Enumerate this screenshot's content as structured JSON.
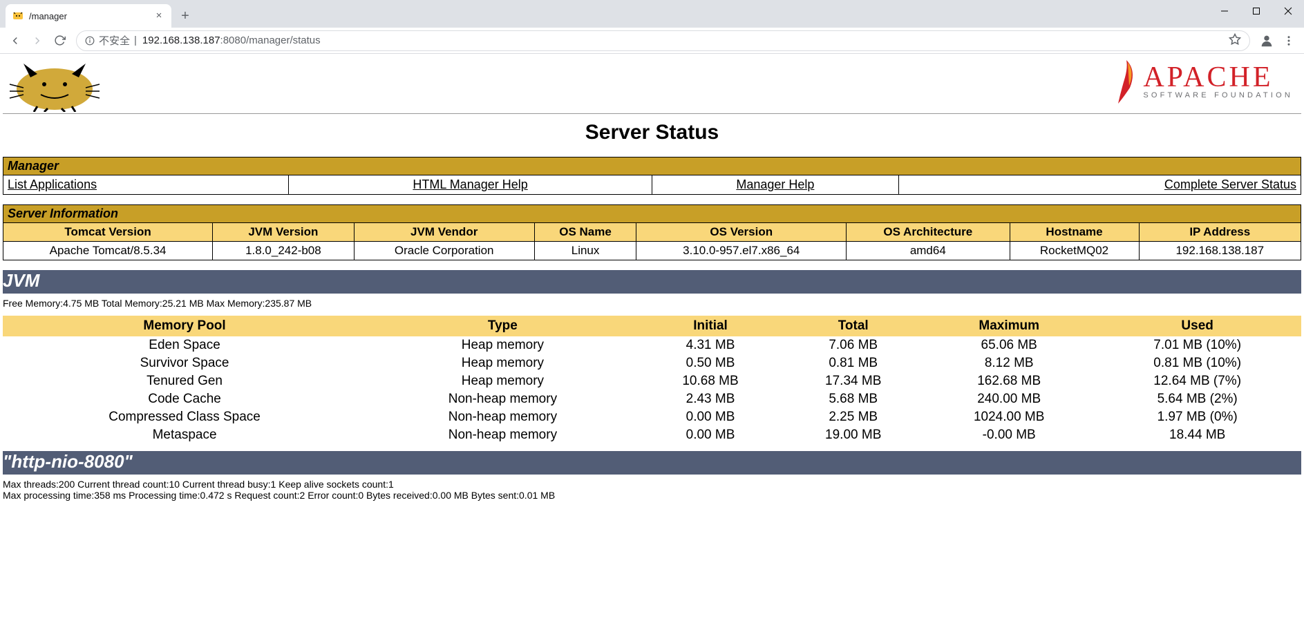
{
  "browser": {
    "tab_title": "/manager",
    "insecure_label": "不安全",
    "url_host": "192.168.138.187",
    "url_port": ":8080",
    "url_path": "/manager/status"
  },
  "header": {
    "page_title": "Server Status",
    "apache_title": "APACHE",
    "apache_sub": "SOFTWARE FOUNDATION"
  },
  "manager": {
    "section": "Manager",
    "links": {
      "list_apps": "List Applications",
      "html_help": "HTML Manager Help",
      "manager_help": "Manager Help",
      "complete_status": "Complete Server Status"
    }
  },
  "server_info": {
    "section": "Server Information",
    "headers": {
      "tomcat_version": "Tomcat Version",
      "jvm_version": "JVM Version",
      "jvm_vendor": "JVM Vendor",
      "os_name": "OS Name",
      "os_version": "OS Version",
      "os_arch": "OS Architecture",
      "hostname": "Hostname",
      "ip": "IP Address"
    },
    "row": {
      "tomcat_version": "Apache Tomcat/8.5.34",
      "jvm_version": "1.8.0_242-b08",
      "jvm_vendor": "Oracle Corporation",
      "os_name": "Linux",
      "os_version": "3.10.0-957.el7.x86_64",
      "os_arch": "amd64",
      "hostname": "RocketMQ02",
      "ip": "192.168.138.187"
    }
  },
  "jvm": {
    "title": "JVM",
    "summary": "Free Memory:4.75 MB Total Memory:25.21 MB Max Memory:235.87 MB",
    "headers": {
      "pool": "Memory Pool",
      "type": "Type",
      "initial": "Initial",
      "total": "Total",
      "max": "Maximum",
      "used": "Used"
    },
    "rows": [
      {
        "pool": "Eden Space",
        "type": "Heap memory",
        "initial": "4.31 MB",
        "total": "7.06 MB",
        "max": "65.06 MB",
        "used": "7.01 MB (10%)"
      },
      {
        "pool": "Survivor Space",
        "type": "Heap memory",
        "initial": "0.50 MB",
        "total": "0.81 MB",
        "max": "8.12 MB",
        "used": "0.81 MB (10%)"
      },
      {
        "pool": "Tenured Gen",
        "type": "Heap memory",
        "initial": "10.68 MB",
        "total": "17.34 MB",
        "max": "162.68 MB",
        "used": "12.64 MB (7%)"
      },
      {
        "pool": "Code Cache",
        "type": "Non-heap memory",
        "initial": "2.43 MB",
        "total": "5.68 MB",
        "max": "240.00 MB",
        "used": "5.64 MB (2%)"
      },
      {
        "pool": "Compressed Class Space",
        "type": "Non-heap memory",
        "initial": "0.00 MB",
        "total": "2.25 MB",
        "max": "1024.00 MB",
        "used": "1.97 MB (0%)"
      },
      {
        "pool": "Metaspace",
        "type": "Non-heap memory",
        "initial": "0.00 MB",
        "total": "19.00 MB",
        "max": "-0.00 MB",
        "used": "18.44 MB"
      }
    ]
  },
  "connector": {
    "title": "\"http-nio-8080\"",
    "line1": "Max threads:200 Current thread count:10 Current thread busy:1 Keep alive sockets count:1",
    "line2": "Max processing time:358 ms Processing time:0.472 s Request count:2 Error count:0 Bytes received:0.00 MB Bytes sent:0.01 MB"
  }
}
